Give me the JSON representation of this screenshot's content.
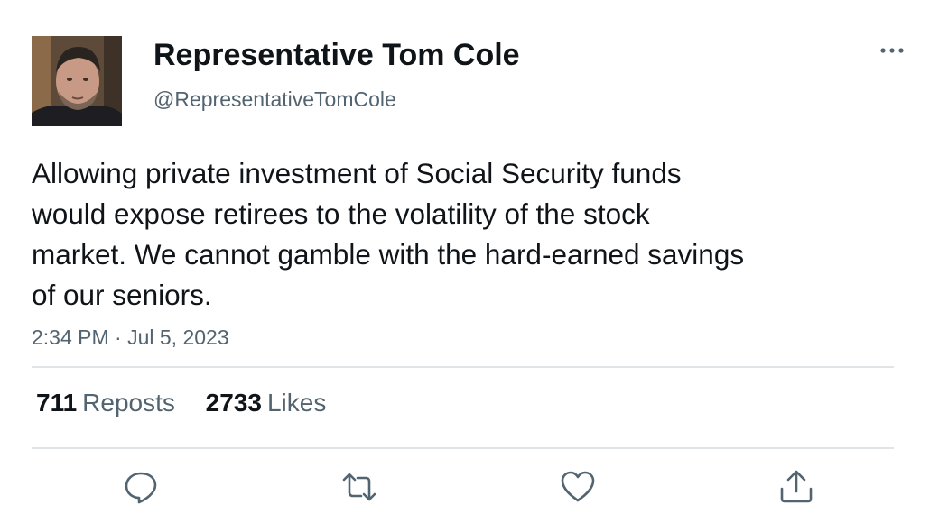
{
  "author": {
    "display_name": "Representative Tom Cole",
    "handle": "@RepresentativeTomCole"
  },
  "tweet": {
    "text_lines": [
      "Allowing private investment of Social Security funds",
      "would expose retirees to the volatility of the stock",
      "market. We cannot gamble with the hard-earned savings",
      "of our seniors."
    ],
    "timestamp": "2:34 PM · Jul 5, 2023"
  },
  "stats": {
    "reposts_count": "711",
    "reposts_label": "Reposts",
    "likes_count": "2733",
    "likes_label": "Likes"
  },
  "icons": {
    "more": "more-options-icon",
    "reply": "reply-icon",
    "repost": "repost-icon",
    "like": "heart-icon",
    "share": "share-icon"
  },
  "colors": {
    "text_primary": "#0f1419",
    "text_secondary": "#536471",
    "divider": "#e1e4e6",
    "icon": "#536471"
  }
}
